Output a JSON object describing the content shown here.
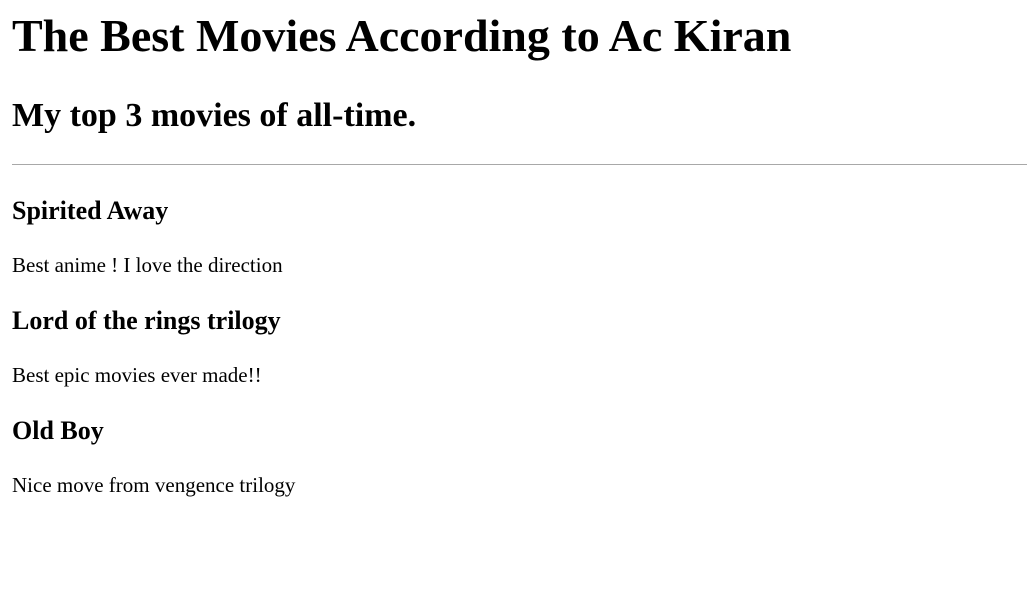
{
  "page": {
    "title": "The Best Movies According to Ac Kiran",
    "subtitle": "My top 3 movies of all-time."
  },
  "movies": [
    {
      "title": "Spirited Away",
      "comment": "Best anime ! I love the direction"
    },
    {
      "title": "Lord of the rings trilogy",
      "comment": "Best epic movies ever made!!"
    },
    {
      "title": "Old Boy",
      "comment": "Nice move from vengence trilogy"
    }
  ]
}
